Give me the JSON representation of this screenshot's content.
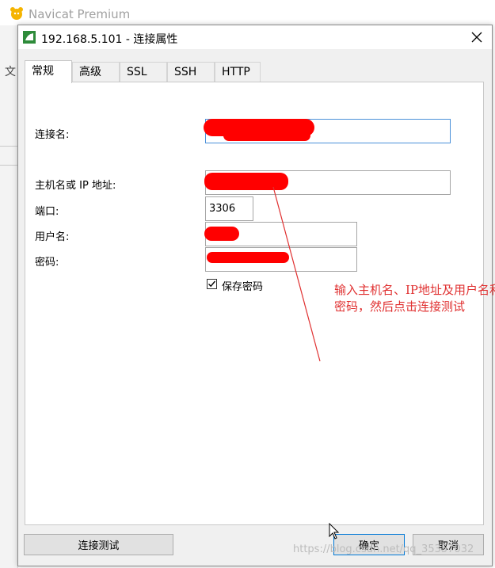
{
  "background_app": {
    "title": "Navicat Premium",
    "menu_char": "文"
  },
  "dialog": {
    "title": "192.168.5.101 - 连接属性",
    "tabs": [
      {
        "label": "常规",
        "active": true
      },
      {
        "label": "高级",
        "active": false
      },
      {
        "label": "SSL",
        "active": false
      },
      {
        "label": "SSH",
        "active": false
      },
      {
        "label": "HTTP",
        "active": false
      }
    ],
    "fields": {
      "connection_name_label": "连接名:",
      "host_label": "主机名或 IP 地址:",
      "port_label": "端口:",
      "port_value": "3306",
      "username_label": "用户名:",
      "password_label": "密码:",
      "save_password_label": "保存密码",
      "save_password_checked": true
    },
    "annotation": "输入主机名、IP地址及用户名和密码，然后点击连接测试",
    "buttons": {
      "test_connection": "连接测试",
      "ok": "确定",
      "cancel": "取消"
    }
  },
  "watermark": "https://blog.csdn.net/qq_35357032",
  "colors": {
    "annotation": "#e03030",
    "redaction": "#ff0000",
    "focus_border": "#4a90d9",
    "default_button_border": "#0078d7"
  }
}
